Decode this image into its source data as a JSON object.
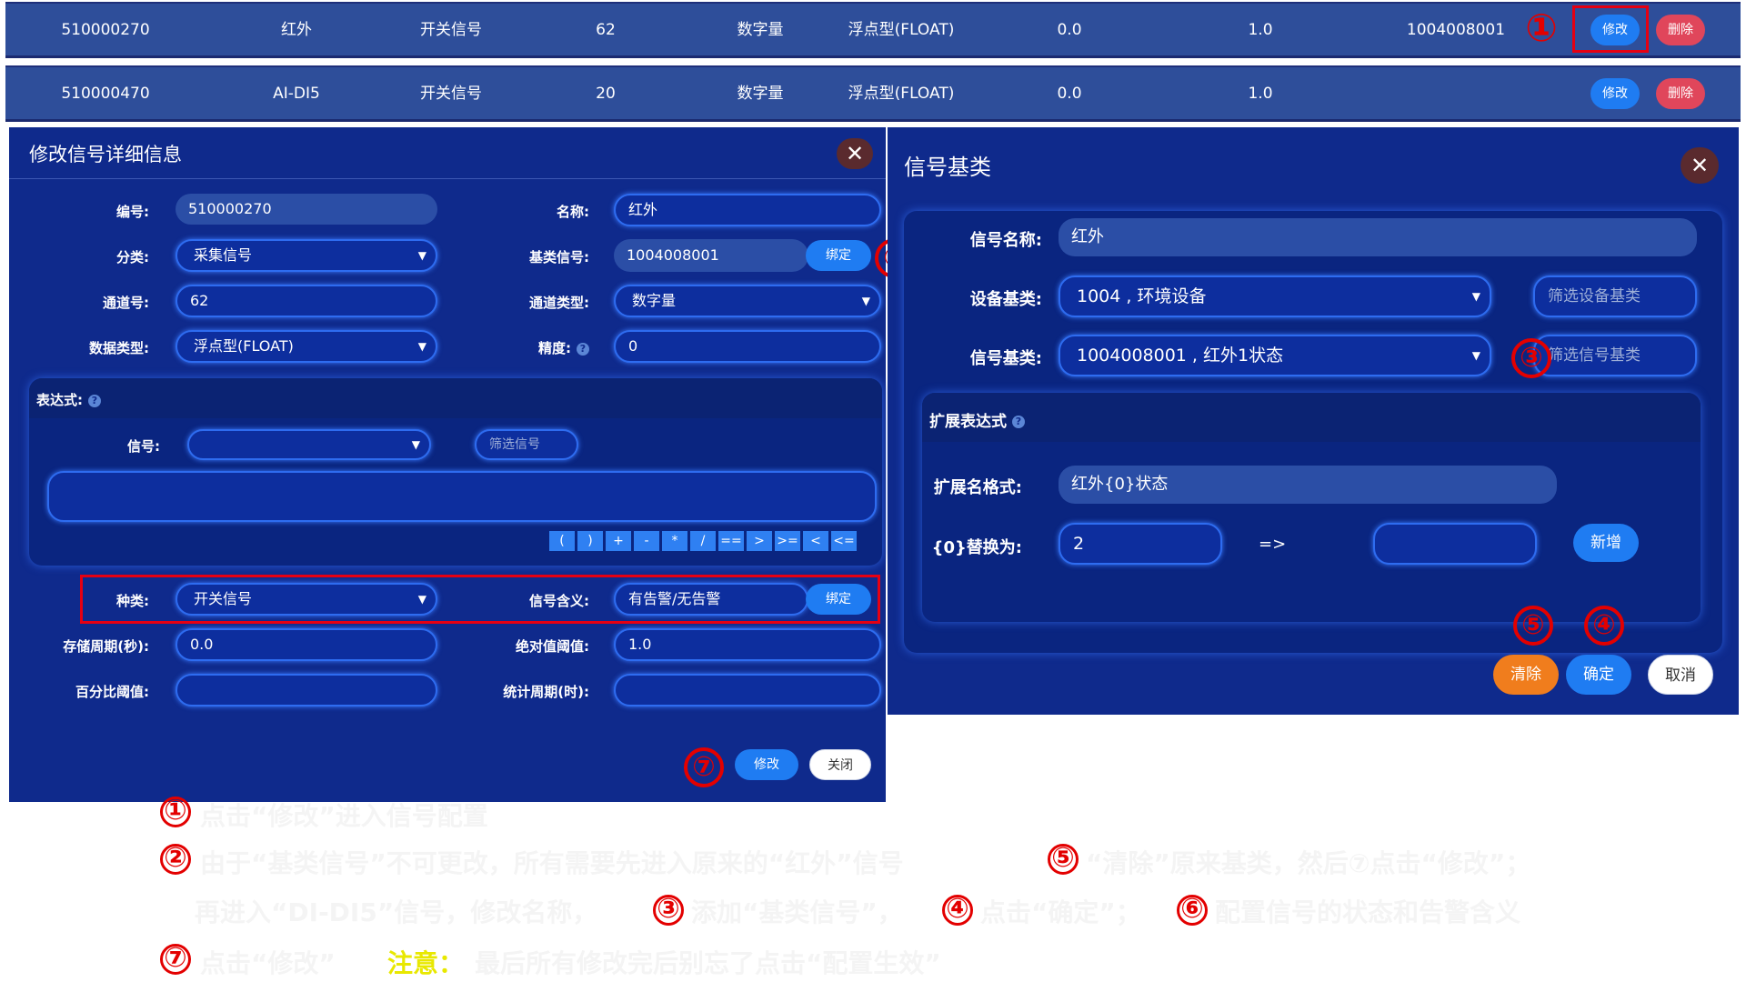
{
  "table": {
    "rows": [
      {
        "id": "510000270",
        "name": "红外",
        "category": "开关信号",
        "channel": "62",
        "channel_type": "数字量",
        "data_type": "浮点型(FLOAT)",
        "v1": "0.0",
        "v2": "1.0",
        "base": "1004008001",
        "edit": "修改",
        "delete": "删除"
      },
      {
        "id": "510000470",
        "name": "AI-DI5",
        "category": "开关信号",
        "channel": "20",
        "channel_type": "数字量",
        "data_type": "浮点型(FLOAT)",
        "v1": "0.0",
        "v2": "1.0",
        "base": "",
        "edit": "修改",
        "delete": "删除"
      }
    ]
  },
  "edit_dialog": {
    "title": "修改信号详细信息",
    "close_icon": "close-x",
    "fields": {
      "id_label": "编号:",
      "id_value": "510000270",
      "name_label": "名称:",
      "name_value": "红外",
      "class_label": "分类:",
      "class_value": "采集信号",
      "base_label": "基类信号:",
      "base_value": "1004008001",
      "base_bind": "绑定",
      "channel_label": "通道号:",
      "channel_value": "62",
      "channel_type_label": "通道类型:",
      "channel_type_value": "数字量",
      "data_type_label": "数据类型:",
      "data_type_value": "浮点型(FLOAT)",
      "precision_label": "精度:",
      "precision_value": "0",
      "kind_label": "种类:",
      "kind_value": "开关信号",
      "meaning_label": "信号含义:",
      "meaning_value": "有告警/无告警",
      "meaning_bind": "绑定",
      "storage_label": "存储周期(秒):",
      "storage_value": "0.0",
      "abs_label": "绝对值阈值:",
      "abs_value": "1.0",
      "percent_label": "百分比阈值:",
      "percent_value": "",
      "stat_label": "统计周期(时):",
      "stat_value": ""
    },
    "expression": {
      "title": "表达式:",
      "signal_label": "信号:",
      "signal_value": "",
      "filter_placeholder": "筛选信号",
      "operators": [
        "(",
        ")",
        "+",
        "-",
        "*",
        "/",
        "==",
        ">",
        ">=",
        "<",
        "<="
      ]
    },
    "buttons": {
      "modify": "修改",
      "close": "关闭"
    }
  },
  "base_dialog": {
    "title": "信号基类",
    "close_icon": "close-x",
    "signal_name_label": "信号名称:",
    "signal_name_value": "红外",
    "device_base_label": "设备基类:",
    "device_base_value": "1004 , 环境设备",
    "device_filter_placeholder": "筛选设备基类",
    "signal_base_label": "信号基类:",
    "signal_base_value": "1004008001 , 红外1状态",
    "signal_filter_placeholder": "筛选信号基类",
    "ext": {
      "title": "扩展表达式",
      "format_label": "扩展名格式:",
      "format_value": "红外{0}状态",
      "replace_label": "{0}替换为:",
      "replace_value": "2",
      "arrow": "=>",
      "replace_target": "",
      "add_button": "新增"
    },
    "buttons": {
      "clear": "清除",
      "confirm": "确定",
      "cancel": "取消"
    }
  },
  "marks": {
    "m1": "①",
    "m2": "②",
    "m3": "③",
    "m4": "④",
    "m5": "⑤",
    "m6": "⑥",
    "m7": "⑦"
  },
  "instructions": {
    "line1_num": "①",
    "line1": "点击“修改”进入信号配置",
    "line2_num": "②",
    "line2a": "由于“基类信号”不可更改，所有需要先进入原来的“红外”信号",
    "line2_num5": "⑤",
    "line2b": "“清除”原来基类，然后⑦点击“修改”；",
    "line3a": "再进入“DI-DI5”信号，修改名称，",
    "line3_num3": "③",
    "line3b": "添加“基类信号”，",
    "line3_num4": "④",
    "line3c": "点击“确定”；",
    "line3_num6": "⑥",
    "line3d": "配置信号的状态和告警含义",
    "line4_num": "⑦",
    "line4a": "点击“修改”",
    "line4_note": "注意：",
    "line4b": "最后所有修改完后别忘了点击“配置生效”"
  },
  "colors": {
    "panel": "#0f2a8c",
    "row": "#2e4e9a",
    "accent_blue": "#1f7cf2",
    "danger": "#e0465b",
    "annotation": "#e30000",
    "note": "#e8e800"
  }
}
